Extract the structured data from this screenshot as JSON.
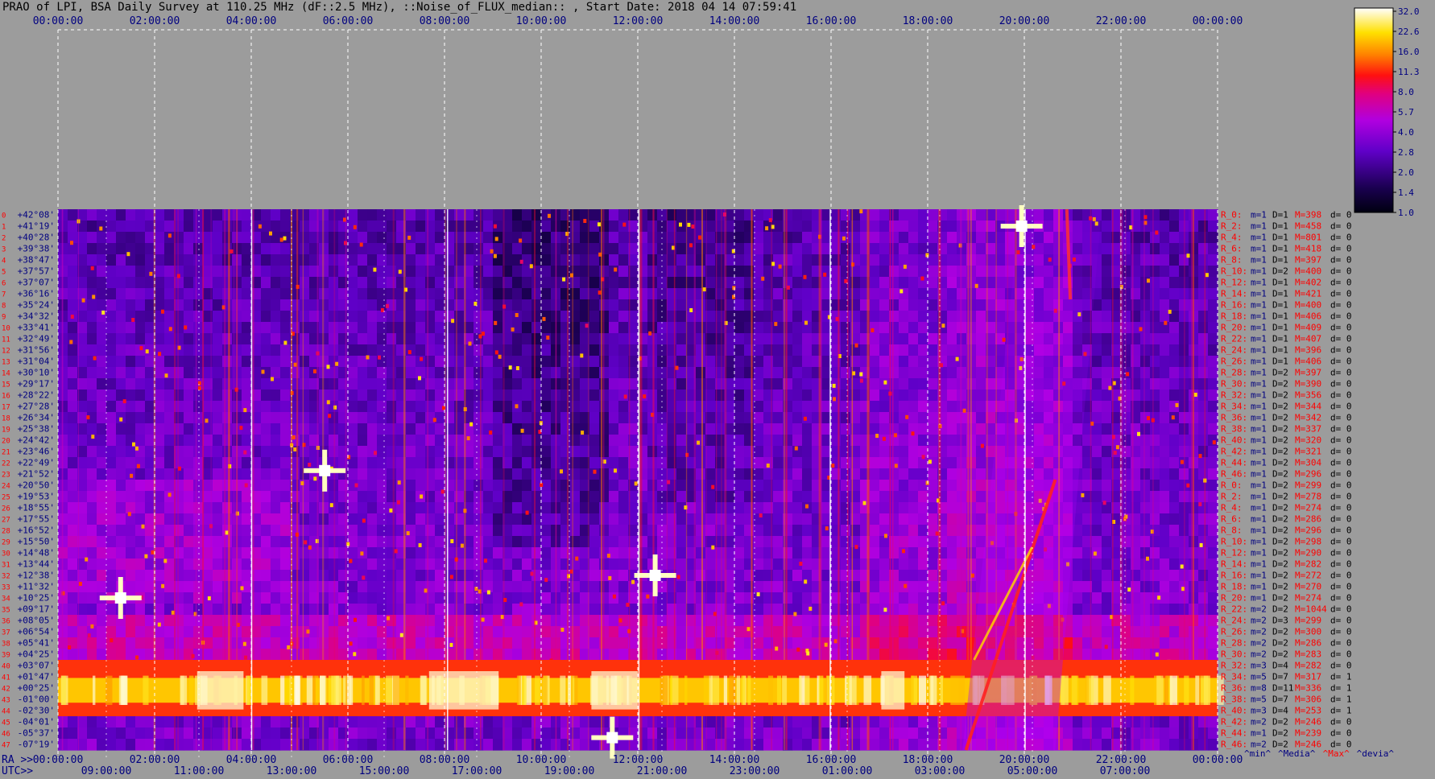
{
  "title": "PRAO of LPI, BSA Daily Survey at 110.25 MHz (dF::2.5 MHz), ::Noise_of_FLUX_median:: , Start Date: 2018 04 14 07:59:41",
  "colors": {
    "background": "#9c9c9c",
    "grid": "#ffffff",
    "label_dark": "#000080",
    "label_red": "#ff0000",
    "label_black": "#000000"
  },
  "chart_data": {
    "type": "heatmap",
    "colormap": "black-purple-red-yellow-white",
    "top_ra_ticks": [
      "00:00:00",
      "02:00:00",
      "04:00:00",
      "06:00:00",
      "08:00:00",
      "10:00:00",
      "12:00:00",
      "14:00:00",
      "16:00:00",
      "18:00:00",
      "20:00:00",
      "22:00:00",
      "00:00:00"
    ],
    "bottom_ra_ticks": [
      "00:00:00",
      "02:00:00",
      "04:00:00",
      "06:00:00",
      "08:00:00",
      "10:00:00",
      "12:00:00",
      "14:00:00",
      "16:00:00",
      "18:00:00",
      "20:00:00",
      "22:00:00",
      "00:00:00"
    ],
    "ra_axis_label": "RA >>",
    "utc_axis_label": "UTC>>",
    "utc_ticks": [
      "09:00:00",
      "11:00:00",
      "13:00:00",
      "15:00:00",
      "17:00:00",
      "19:00:00",
      "21:00:00",
      "23:00:00",
      "01:00:00",
      "03:00:00",
      "05:00:00",
      "07:00:00"
    ],
    "colorbar": {
      "values": [
        "32.0",
        "22.6",
        "16.0",
        "11.3",
        "8.0",
        "5.7",
        "4.0",
        "2.8",
        "2.0",
        "1.4",
        "1.0"
      ],
      "scale": "log"
    },
    "dec_labels": [
      "+42°08'",
      "+41°19'",
      "+40°28'",
      "+39°38'",
      "+38°47'",
      "+37°57'",
      "+37°07'",
      "+36°16'",
      "+35°24'",
      "+34°32'",
      "+33°41'",
      "+32°49'",
      "+31°56'",
      "+31°04'",
      "+30°10'",
      "+29°17'",
      "+28°22'",
      "+27°28'",
      "+26°34'",
      "+25°38'",
      "+24°42'",
      "+23°46'",
      "+22°49'",
      "+21°52'",
      "+20°50'",
      "+19°53'",
      "+18°55'",
      "+17°55'",
      "+16°52'",
      "+15°50'",
      "+14°48'",
      "+13°44'",
      "+12°38'",
      "+11°32'",
      "+10°25'",
      "+09°17'",
      "+08°05'",
      "+06°54'",
      "+05°41'",
      "+04°25'",
      "+03°07'",
      "+01°47'",
      "+00°25'",
      "-01°00'",
      "-02°30'",
      "-04°01'",
      "-05°37'",
      "-07°19'"
    ],
    "ray_stats": [
      {
        "r": "R_0:",
        "m": "m=1",
        "d": "D=1",
        "M": "M=398",
        "dd": "d= 0"
      },
      {
        "r": "R_2:",
        "m": "m=1",
        "d": "D=1",
        "M": "M=458",
        "dd": "d= 0"
      },
      {
        "r": "R_4:",
        "m": "m=1",
        "d": "D=1",
        "M": "M=801",
        "dd": "d= 0"
      },
      {
        "r": "R_6:",
        "m": "m=1",
        "d": "D=1",
        "M": "M=418",
        "dd": "d= 0"
      },
      {
        "r": "R_8:",
        "m": "m=1",
        "d": "D=1",
        "M": "M=397",
        "dd": "d= 0"
      },
      {
        "r": "R_10:",
        "m": "m=1",
        "d": "D=2",
        "M": "M=400",
        "dd": "d= 0"
      },
      {
        "r": "R_12:",
        "m": "m=1",
        "d": "D=1",
        "M": "M=402",
        "dd": "d= 0"
      },
      {
        "r": "R_14:",
        "m": "m=1",
        "d": "D=1",
        "M": "M=421",
        "dd": "d= 0"
      },
      {
        "r": "R_16:",
        "m": "m=1",
        "d": "D=1",
        "M": "M=400",
        "dd": "d= 0"
      },
      {
        "r": "R_18:",
        "m": "m=1",
        "d": "D=1",
        "M": "M=406",
        "dd": "d= 0"
      },
      {
        "r": "R_20:",
        "m": "m=1",
        "d": "D=1",
        "M": "M=409",
        "dd": "d= 0"
      },
      {
        "r": "R_22:",
        "m": "m=1",
        "d": "D=1",
        "M": "M=407",
        "dd": "d= 0"
      },
      {
        "r": "R_24:",
        "m": "m=1",
        "d": "D=1",
        "M": "M=396",
        "dd": "d= 0"
      },
      {
        "r": "R_26:",
        "m": "m=1",
        "d": "D=1",
        "M": "M=406",
        "dd": "d= 0"
      },
      {
        "r": "R_28:",
        "m": "m=1",
        "d": "D=2",
        "M": "M=397",
        "dd": "d= 0"
      },
      {
        "r": "R_30:",
        "m": "m=1",
        "d": "D=2",
        "M": "M=390",
        "dd": "d= 0"
      },
      {
        "r": "R_32:",
        "m": "m=1",
        "d": "D=2",
        "M": "M=356",
        "dd": "d= 0"
      },
      {
        "r": "R_34:",
        "m": "m=1",
        "d": "D=2",
        "M": "M=344",
        "dd": "d= 0"
      },
      {
        "r": "R_36:",
        "m": "m=1",
        "d": "D=2",
        "M": "M=342",
        "dd": "d= 0"
      },
      {
        "r": "R_38:",
        "m": "m=1",
        "d": "D=2",
        "M": "M=337",
        "dd": "d= 0"
      },
      {
        "r": "R_40:",
        "m": "m=1",
        "d": "D=2",
        "M": "M=320",
        "dd": "d= 0"
      },
      {
        "r": "R_42:",
        "m": "m=1",
        "d": "D=2",
        "M": "M=321",
        "dd": "d= 0"
      },
      {
        "r": "R_44:",
        "m": "m=1",
        "d": "D=2",
        "M": "M=304",
        "dd": "d= 0"
      },
      {
        "r": "R_46:",
        "m": "m=1",
        "d": "D=2",
        "M": "M=296",
        "dd": "d= 0"
      },
      {
        "r": "R_0:",
        "m": "m=1",
        "d": "D=2",
        "M": "M=299",
        "dd": "d= 0"
      },
      {
        "r": "R_2:",
        "m": "m=1",
        "d": "D=2",
        "M": "M=278",
        "dd": "d= 0"
      },
      {
        "r": "R_4:",
        "m": "m=1",
        "d": "D=2",
        "M": "M=274",
        "dd": "d= 0"
      },
      {
        "r": "R_6:",
        "m": "m=1",
        "d": "D=2",
        "M": "M=286",
        "dd": "d= 0"
      },
      {
        "r": "R_8:",
        "m": "m=1",
        "d": "D=2",
        "M": "M=296",
        "dd": "d= 0"
      },
      {
        "r": "R_10:",
        "m": "m=1",
        "d": "D=2",
        "M": "M=298",
        "dd": "d= 0"
      },
      {
        "r": "R_12:",
        "m": "m=1",
        "d": "D=2",
        "M": "M=290",
        "dd": "d= 0"
      },
      {
        "r": "R_14:",
        "m": "m=1",
        "d": "D=2",
        "M": "M=282",
        "dd": "d= 0"
      },
      {
        "r": "R_16:",
        "m": "m=1",
        "d": "D=2",
        "M": "M=272",
        "dd": "d= 0"
      },
      {
        "r": "R_18:",
        "m": "m=1",
        "d": "D=2",
        "M": "M=270",
        "dd": "d= 0"
      },
      {
        "r": "R_20:",
        "m": "m=1",
        "d": "D=2",
        "M": "M=274",
        "dd": "d= 0"
      },
      {
        "r": "R_22:",
        "m": "m=2",
        "d": "D=2",
        "M": "M=1044",
        "dd": "d= 0"
      },
      {
        "r": "R_24:",
        "m": "m=2",
        "d": "D=3",
        "M": "M=299",
        "dd": "d= 0"
      },
      {
        "r": "R_26:",
        "m": "m=2",
        "d": "D=2",
        "M": "M=300",
        "dd": "d= 0"
      },
      {
        "r": "R_28:",
        "m": "m=2",
        "d": "D=2",
        "M": "M=286",
        "dd": "d= 0"
      },
      {
        "r": "R_30:",
        "m": "m=2",
        "d": "D=2",
        "M": "M=283",
        "dd": "d= 0"
      },
      {
        "r": "R_32:",
        "m": "m=3",
        "d": "D=4",
        "M": "M=282",
        "dd": "d= 0"
      },
      {
        "r": "R_34:",
        "m": "m=5",
        "d": "D=7",
        "M": "M=317",
        "dd": "d= 1"
      },
      {
        "r": "R_36:",
        "m": "m=8",
        "d": "D=11",
        "M": "M=336",
        "dd": "d= 1"
      },
      {
        "r": "R_38:",
        "m": "m=5",
        "d": "D=7",
        "M": "M=306",
        "dd": "d= 1"
      },
      {
        "r": "R_40:",
        "m": "m=3",
        "d": "D=4",
        "M": "M=253",
        "dd": "d= 1"
      },
      {
        "r": "R_42:",
        "m": "m=2",
        "d": "D=2",
        "M": "M=246",
        "dd": "d= 0"
      },
      {
        "r": "R_44:",
        "m": "m=1",
        "d": "D=2",
        "M": "M=239",
        "dd": "d= 0"
      },
      {
        "r": "R_46:",
        "m": "m=2",
        "d": "D=2",
        "M": "M=246",
        "dd": "d= 0"
      }
    ],
    "stats_legend": [
      {
        "text": "^min^",
        "color": "#000080"
      },
      {
        "text": "^Media^",
        "color": "#000080"
      },
      {
        "text": "^Max^",
        "color": "#ff0000"
      },
      {
        "text": "^devia^",
        "color": "#000080"
      }
    ]
  }
}
